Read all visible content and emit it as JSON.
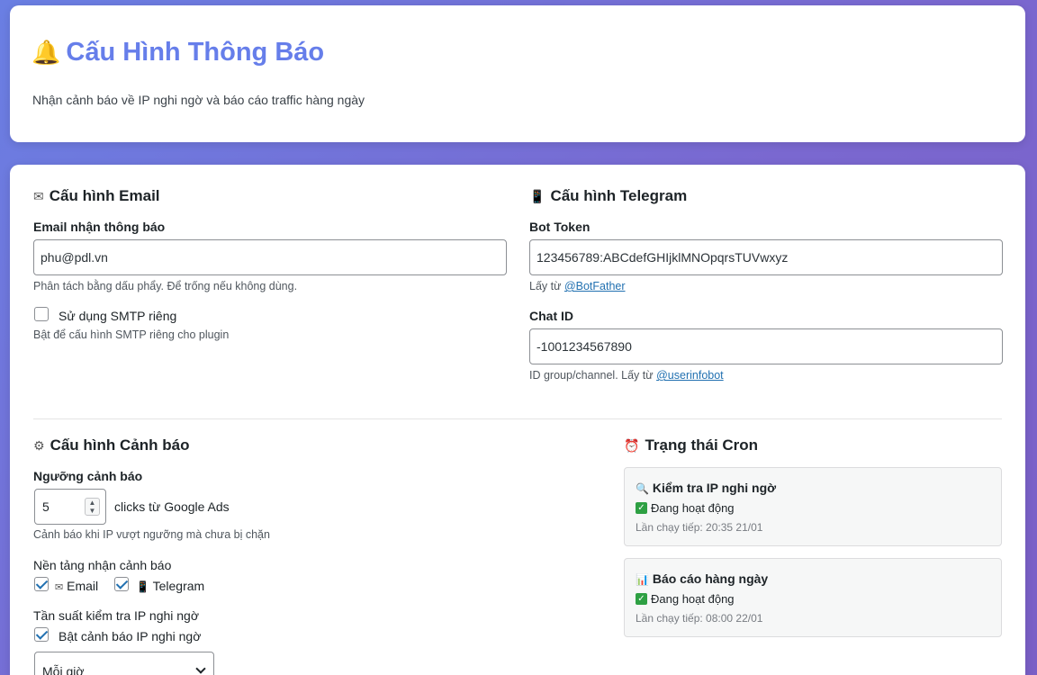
{
  "header": {
    "title_icon": "bell-icon",
    "title": "Cấu Hình Thông Báo",
    "subtitle": "Nhận cảnh báo về IP nghi ngờ và báo cáo traffic hàng ngày"
  },
  "email_section": {
    "icon": "email-icon",
    "heading": "Cấu hình Email",
    "email_label": "Email nhận thông báo",
    "email_value": "phu@pdl.vn",
    "email_hint": "Phân tách bằng dấu phẩy. Để trống nếu không dùng.",
    "smtp_label": "Sử dụng SMTP riêng",
    "smtp_checked": false,
    "smtp_hint": "Bật để cấu hình SMTP riêng cho plugin"
  },
  "telegram_section": {
    "icon": "phone-icon",
    "heading": "Cấu hình Telegram",
    "token_label": "Bot Token",
    "token_value": "123456789:ABCdefGHIjklMNOpqrsTUVwxyz",
    "token_hint_prefix": "Lấy từ",
    "token_hint_link": "@BotFather",
    "chat_label": "Chat ID",
    "chat_value": "-1001234567890",
    "chat_hint_prefix": "ID group/channel. Lấy từ",
    "chat_hint_link": "@userinfobot"
  },
  "alert_section": {
    "icon": "gear-icon",
    "heading": "Cấu hình Cảnh báo",
    "threshold_label": "Ngưỡng cảnh báo",
    "threshold_value": "5",
    "threshold_suffix": "clicks từ Google Ads",
    "threshold_hint": "Cảnh báo khi IP vượt ngưỡng mà chưa bị chặn",
    "platform_label": "Nền tảng nhận cảnh báo",
    "platform_email": "Email",
    "platform_telegram": "Telegram",
    "frequency_label": "Tần suất kiểm tra IP nghi ngờ",
    "enable_label": "Bật cảnh báo IP nghi ngờ",
    "frequency_value": "Mỗi giờ"
  },
  "cron_section": {
    "icon": "alarm-clock-icon",
    "heading": "Trạng thái Cron",
    "jobs": [
      {
        "icon": "magnifier-icon",
        "title": "Kiểm tra IP nghi ngờ",
        "status": "Đang hoạt động",
        "next": "Lần chạy tiếp: 20:35 21/01"
      },
      {
        "icon": "bar-chart-icon",
        "title": "Báo cáo hàng ngày",
        "status": "Đang hoạt động",
        "next": "Lần chạy tiếp: 08:00 22/01"
      }
    ]
  }
}
